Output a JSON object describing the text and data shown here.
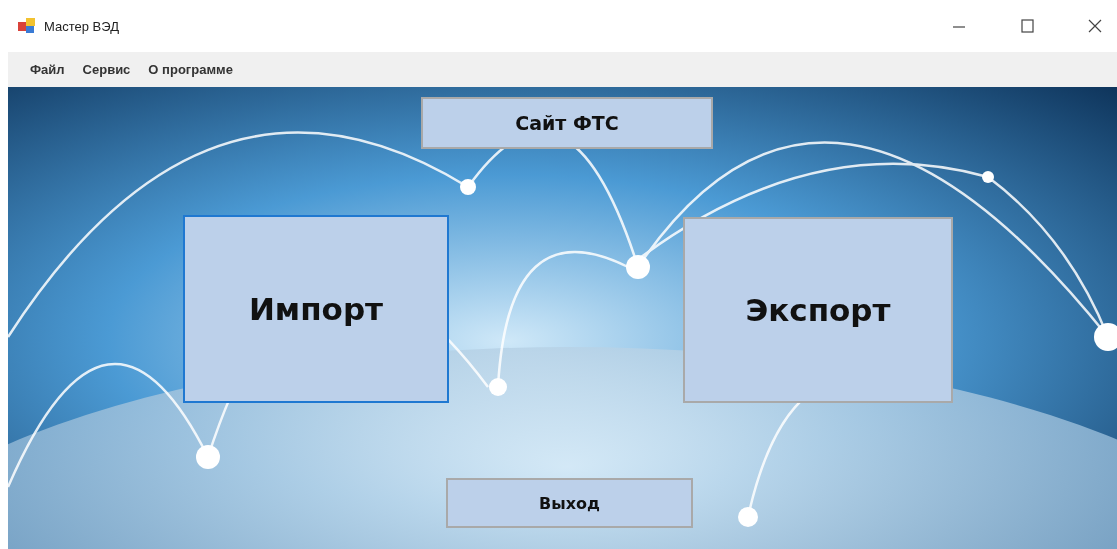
{
  "window": {
    "title": "Мастер ВЭД"
  },
  "menu": [
    "Файл",
    "Сервис",
    "О программе"
  ],
  "buttons": [
    {
      "label": "Сайт ФТС",
      "kind": "top",
      "focused": false
    },
    {
      "label": "Импорт",
      "kind": "large-left",
      "focused": true
    },
    {
      "label": "Экспорт",
      "kind": "large-right",
      "focused": false
    },
    {
      "label": "Выход",
      "kind": "bottom",
      "focused": false
    }
  ]
}
